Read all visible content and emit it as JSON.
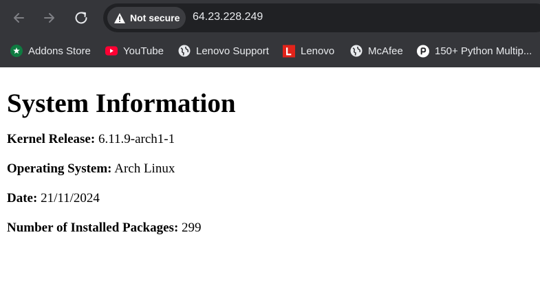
{
  "browser": {
    "address_bar": {
      "security_label": "Not secure",
      "url": "64.23.228.249"
    },
    "bookmarks": [
      {
        "label": "Addons Store",
        "icon": "addons-store-icon",
        "color": "#0f7b41"
      },
      {
        "label": "YouTube",
        "icon": "youtube-icon",
        "color": "#ff0033"
      },
      {
        "label": "Lenovo Support",
        "icon": "globe-icon",
        "color": "#e8eaed"
      },
      {
        "label": "Lenovo",
        "icon": "lenovo-icon",
        "color": "#e2231a"
      },
      {
        "label": "McAfee",
        "icon": "globe-icon",
        "color": "#e8eaed"
      },
      {
        "label": "150+ Python Multip...",
        "icon": "p-letter-icon",
        "color": "#ffffff"
      }
    ]
  },
  "page": {
    "title": "System Information",
    "info": [
      {
        "label": "Kernel Release:",
        "value": "6.11.9-arch1-1"
      },
      {
        "label": "Operating System:",
        "value": "Arch Linux"
      },
      {
        "label": "Date:",
        "value": "21/11/2024"
      },
      {
        "label": "Number of Installed Packages:",
        "value": "299"
      }
    ]
  }
}
